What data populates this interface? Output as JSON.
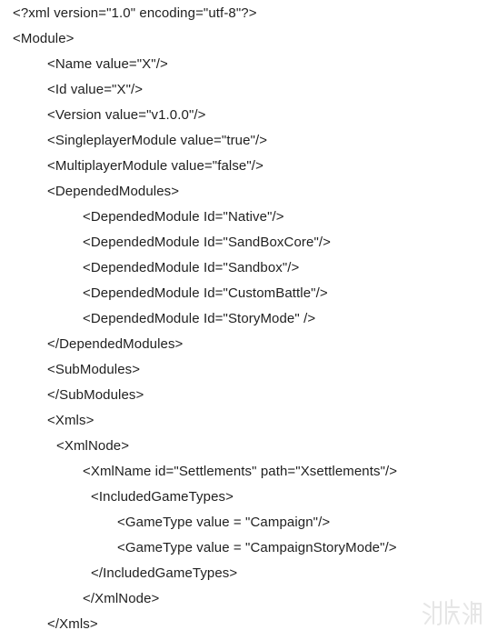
{
  "document": {
    "lines": [
      "<?xml version=\"1.0\" encoding=\"utf-8\"?>",
      "<Module>",
      "<Name value=\"X\"/>",
      "<Id value=\"X\"/>",
      "<Version value=\"v1.0.0\"/>",
      "<SingleplayerModule value=\"true\"/>",
      "<MultiplayerModule value=\"false\"/>",
      "<DependedModules>",
      "<DependedModule Id=\"Native\"/>",
      "<DependedModule Id=\"SandBoxCore\"/>",
      "<DependedModule Id=\"Sandbox\"/>",
      "<DependedModule Id=\"CustomBattle\"/>",
      "<DependedModule Id=\"StoryMode\" />",
      "</DependedModules>",
      "<SubModules>",
      "</SubModules>",
      "<Xmls>",
      "<XmlNode>",
      "<XmlName id=\"Settlements\" path=\"Xsettlements\"/>",
      "<IncludedGameTypes>",
      "<GameType value = \"Campaign\"/>",
      "<GameType value = \"CampaignStoryMode\"/>",
      "</IncludedGameTypes>",
      "</XmlNode>",
      "</Xmls>"
    ]
  },
  "watermark": {
    "text": "游侠网",
    "color": "#9a9a9a"
  }
}
